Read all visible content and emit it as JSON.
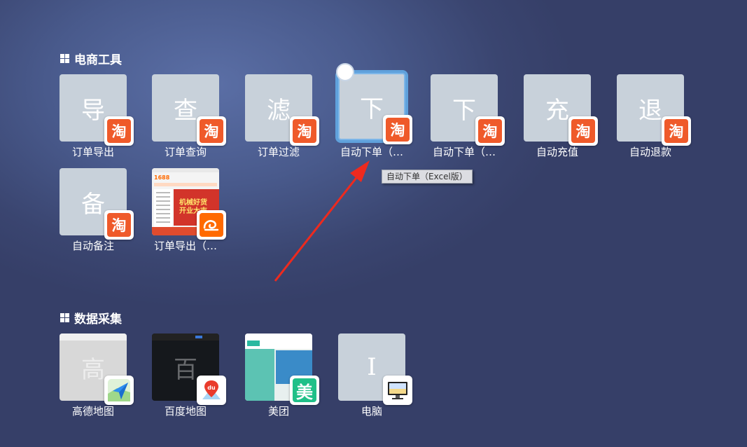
{
  "sections": [
    {
      "title": "电商工具"
    },
    {
      "title": "数据采集"
    }
  ],
  "ecommerce": [
    {
      "glyph": "导",
      "label": "订单导出",
      "badge": "淘"
    },
    {
      "glyph": "查",
      "label": "订单查询",
      "badge": "淘"
    },
    {
      "glyph": "滤",
      "label": "订单过滤",
      "badge": "淘"
    },
    {
      "glyph": "下",
      "label": "自动下单（…",
      "badge": "淘"
    },
    {
      "glyph": "下",
      "label": "自动下单（…",
      "badge": "淘"
    },
    {
      "glyph": "充",
      "label": "自动充值",
      "badge": "淘"
    },
    {
      "glyph": "退",
      "label": "自动退款",
      "badge": "淘"
    },
    {
      "glyph": "备",
      "label": "自动备注",
      "badge": "淘"
    },
    {
      "glyph": "",
      "label": "订单导出（…",
      "badge": "1688",
      "shot_text": "机械好货\n开业大吉",
      "shot_logo": "1688"
    }
  ],
  "datacollect": [
    {
      "glyph": "高",
      "label": "高德地图",
      "badge": "gaode"
    },
    {
      "glyph": "百",
      "label": "百度地图",
      "badge": "du"
    },
    {
      "glyph": "美",
      "label": "美团",
      "badge": "美"
    },
    {
      "glyph": "I",
      "label": "电脑",
      "badge": "computer"
    }
  ],
  "tooltip": "自动下单（Excel版）",
  "colors": {
    "taobao": "#ef5a2a",
    "meituan": "#20c088",
    "selection": "#5fa1dc",
    "arrow": "#ee2a1e"
  }
}
